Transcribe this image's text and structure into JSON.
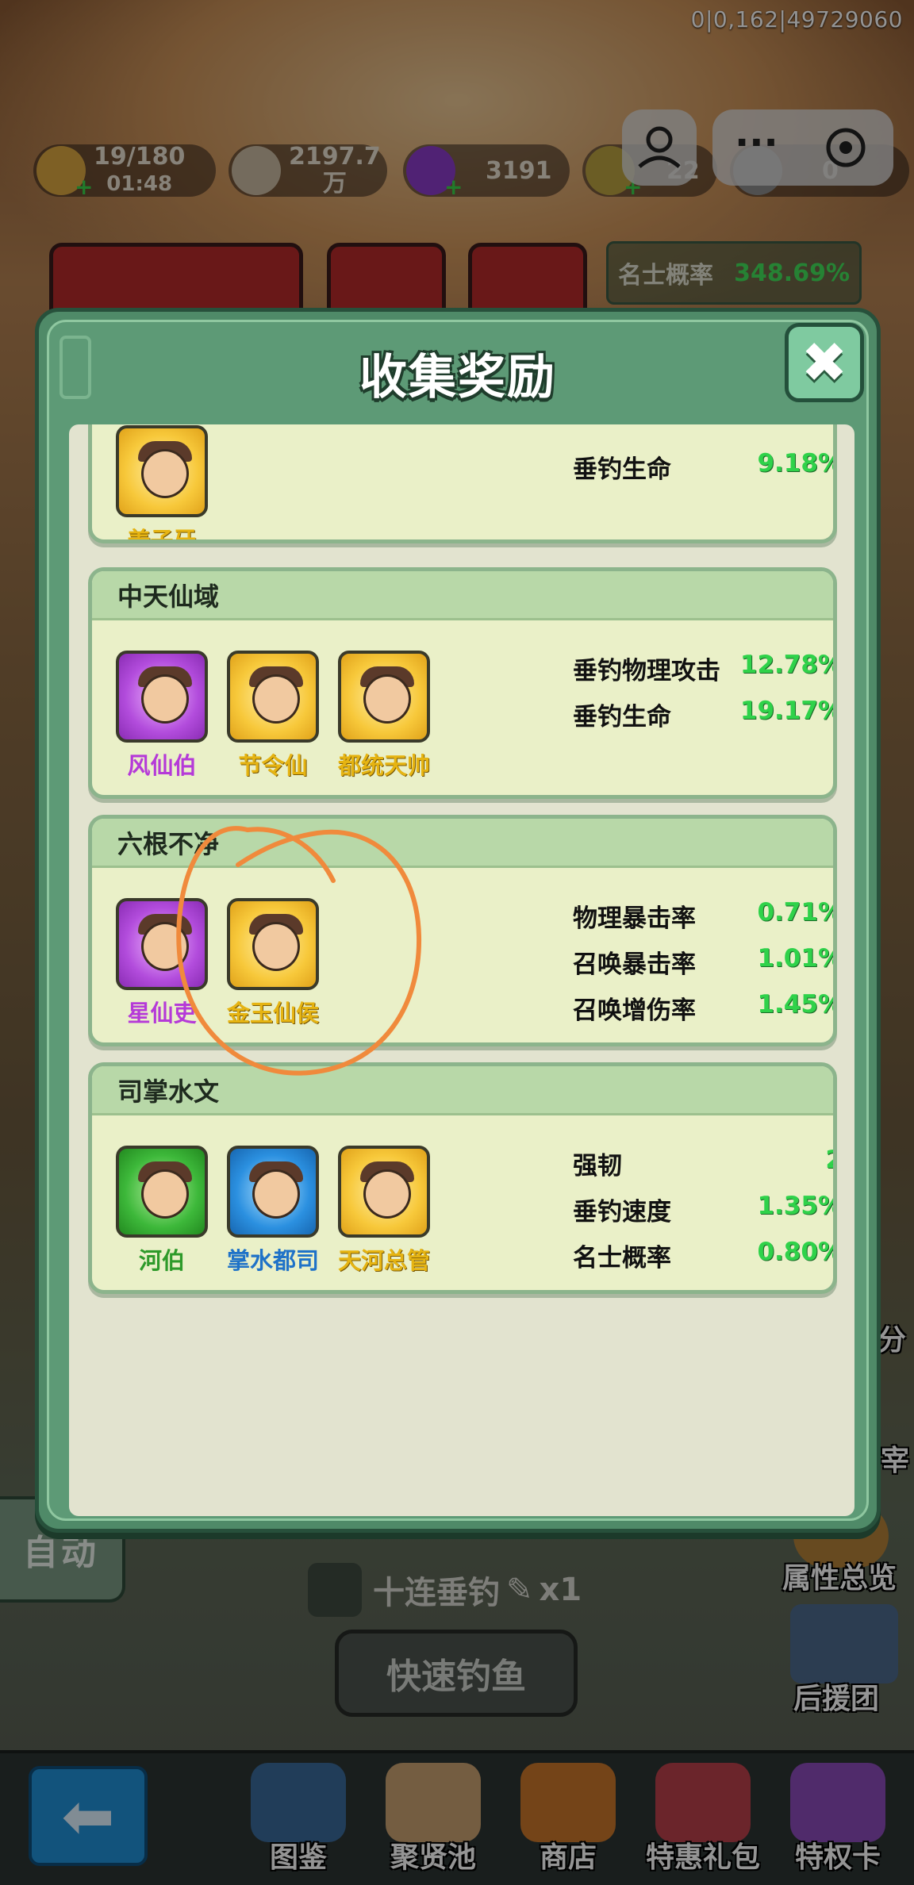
{
  "session_id": "0|0,162|49729060",
  "resources": [
    {
      "value": "19/180",
      "sub": "01:48",
      "icon": "gold-ingot-icon",
      "color": "#d9a640"
    },
    {
      "value": "2197.7",
      "sub": "万",
      "icon": "coin-icon",
      "color": "#c9b9a0"
    },
    {
      "value": "3191",
      "sub": "",
      "icon": "purple-gem-icon",
      "color": "#8a3cc8"
    },
    {
      "value": "22",
      "sub": "",
      "icon": "green-token-icon",
      "color": "#b8a040"
    },
    {
      "value": "0",
      "sub": "",
      "icon": "fishing-rod-icon",
      "color": "#8a8a8a"
    }
  ],
  "luck": {
    "label": "名士概率",
    "value": "348.69%"
  },
  "modal": {
    "title": "收集奖励",
    "close_label": "✖",
    "groups": [
      {
        "title": "",
        "heroes": [
          {
            "name": "姜子牙",
            "rarity": "gold"
          }
        ],
        "stats": [
          {
            "label": "垂钓生命",
            "value": "9.18%"
          }
        ]
      },
      {
        "title": "中天仙域",
        "heroes": [
          {
            "name": "风仙伯",
            "rarity": "purple"
          },
          {
            "name": "节令仙",
            "rarity": "gold"
          },
          {
            "name": "都统天帅",
            "rarity": "gold"
          }
        ],
        "stats": [
          {
            "label": "垂钓物理攻击",
            "value": "12.78%"
          },
          {
            "label": "垂钓生命",
            "value": "19.17%"
          }
        ]
      },
      {
        "title": "六根不净",
        "heroes": [
          {
            "name": "星仙吏",
            "rarity": "purple"
          },
          {
            "name": "金玉仙侯",
            "rarity": "gold"
          }
        ],
        "stats": [
          {
            "label": "物理暴击率",
            "value": "0.71%"
          },
          {
            "label": "召唤暴击率",
            "value": "1.01%"
          },
          {
            "label": "召唤增伤率",
            "value": "1.45%"
          }
        ]
      },
      {
        "title": "司掌水文",
        "heroes": [
          {
            "name": "河伯",
            "rarity": "green"
          },
          {
            "name": "掌水都司",
            "rarity": "blue"
          },
          {
            "name": "天河总管",
            "rarity": "gold"
          }
        ],
        "stats": [
          {
            "label": "强韧",
            "value": "2"
          },
          {
            "label": "垂钓速度",
            "value": "1.35%"
          },
          {
            "label": "名士概率",
            "value": "0.80%"
          }
        ]
      }
    ]
  },
  "auto_button": "自动",
  "ten_fish": {
    "label": "十连垂钓",
    "count": "x1"
  },
  "quick_fish_button": "快速钓鱼",
  "side_labels": {
    "attribute_overview": "属性总览",
    "support_team": "后援团",
    "fen": "分",
    "zai": "宰"
  },
  "nav": [
    {
      "label": "图鉴",
      "icon": "book-icon"
    },
    {
      "label": "聚贤池",
      "icon": "scroll-icon"
    },
    {
      "label": "商店",
      "icon": "shop-icon"
    },
    {
      "label": "特惠礼包",
      "icon": "gift-icon"
    },
    {
      "label": "特权卡",
      "icon": "privilege-card-icon"
    }
  ],
  "colors": {
    "accent_green": "#2fd24a",
    "modal_green": "#4f8a68",
    "annotation": "#f08a3c"
  }
}
